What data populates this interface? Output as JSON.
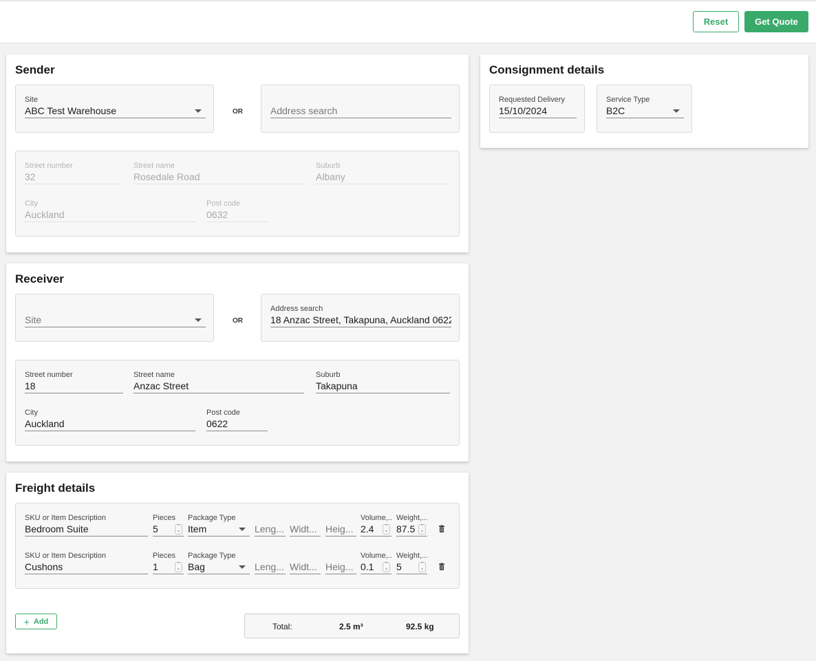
{
  "header": {
    "reset_label": "Reset",
    "quote_label": "Get Quote"
  },
  "sender": {
    "title": "Sender",
    "site": {
      "label": "Site",
      "value": "ABC Test Warehouse"
    },
    "or": "OR",
    "address_search": {
      "placeholder": "Address search"
    },
    "street_number": {
      "label": "Street number",
      "value": "32"
    },
    "street_name": {
      "label": "Street name",
      "value": "Rosedale Road"
    },
    "suburb": {
      "label": "Suburb",
      "value": "Albany"
    },
    "city": {
      "label": "City",
      "value": "Auckland"
    },
    "post_code": {
      "label": "Post code",
      "value": "0632"
    }
  },
  "receiver": {
    "title": "Receiver",
    "site": {
      "placeholder": "Site"
    },
    "or": "OR",
    "address_search": {
      "label": "Address search",
      "value": "18 Anzac Street, Takapuna, Auckland 0622"
    },
    "street_number": {
      "label": "Street number",
      "value": "18"
    },
    "street_name": {
      "label": "Street name",
      "value": "Anzac Street"
    },
    "suburb": {
      "label": "Suburb",
      "value": "Takapuna"
    },
    "city": {
      "label": "City",
      "value": "Auckland"
    },
    "post_code": {
      "label": "Post code",
      "value": "0622"
    }
  },
  "consignment": {
    "title": "Consignment details",
    "requested_delivery": {
      "label": "Requested Delivery",
      "value": "15/10/2024"
    },
    "service_type": {
      "label": "Service Type",
      "value": "B2C"
    }
  },
  "freight": {
    "title": "Freight details",
    "columns": {
      "sku": "SKU or Item Description",
      "pieces": "Pieces",
      "package_type": "Package Type",
      "length": "Leng...",
      "width": "Widt...",
      "height": "Heig...",
      "volume": "Volume,...",
      "weight": "Weight,..."
    },
    "rows": [
      {
        "sku": "Bedroom Suite",
        "pieces": "5",
        "package_type": "Item",
        "volume": "2.4",
        "weight": "87.5"
      },
      {
        "sku": "Cushons",
        "pieces": "1",
        "package_type": "Bag",
        "volume": "0.1",
        "weight": "5"
      }
    ],
    "add_label": "Add",
    "totals": {
      "label": "Total:",
      "volume": "2.5 m³",
      "weight": "92.5 kg"
    }
  },
  "colors": {
    "accent": "#3aaa6b",
    "background": "#f2f2f2"
  },
  "icons": {
    "trash": "trash-icon",
    "add": "plus-icon",
    "dropdown": "chevron-down-icon",
    "stepper": "stepper-icon"
  }
}
